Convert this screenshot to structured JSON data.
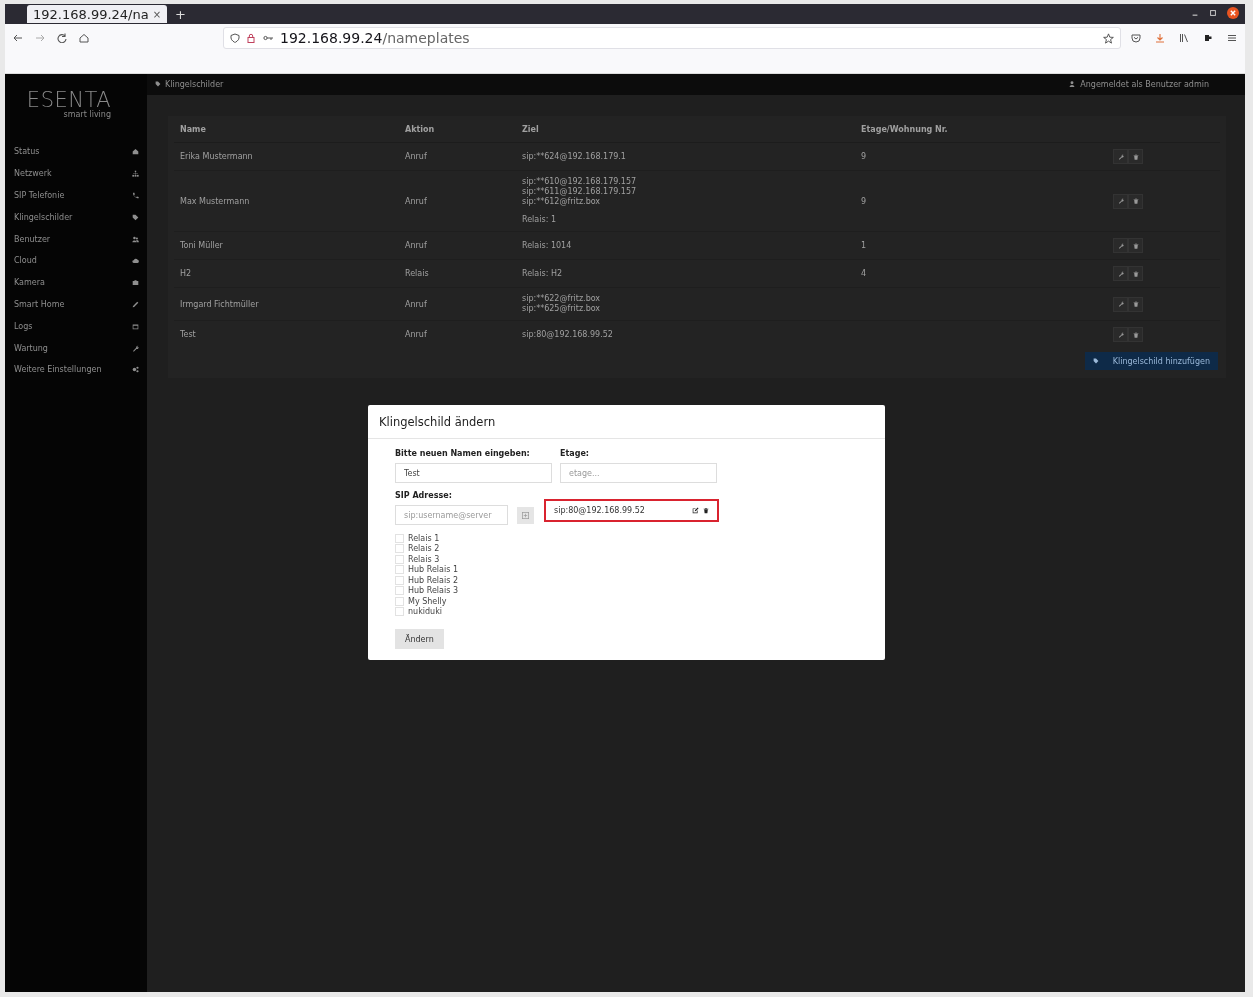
{
  "browser": {
    "tab_title": "192.168.99.24/na",
    "tab_close": "×",
    "new_tab": "+",
    "url_host": "192.168.99.24",
    "url_path": "/nameplates"
  },
  "sidebar": {
    "logo": "ESENTA",
    "tagline": "smart living",
    "items": [
      {
        "label": "Status"
      },
      {
        "label": "Netzwerk"
      },
      {
        "label": "SIP Telefonie"
      },
      {
        "label": "Klingelschilder"
      },
      {
        "label": "Benutzer"
      },
      {
        "label": "Cloud"
      },
      {
        "label": "Kamera"
      },
      {
        "label": "Smart Home"
      },
      {
        "label": "Logs"
      },
      {
        "label": "Wartung"
      },
      {
        "label": "Weitere Einstellungen"
      }
    ]
  },
  "header": {
    "title": "Klingelschilder",
    "user": "Angemeldet als Benutzer admin"
  },
  "table": {
    "columns": [
      "Name",
      "Aktion",
      "Ziel",
      "Etage/Wohnung Nr."
    ],
    "rows": [
      {
        "name": "Erika Mustermann",
        "action": "Anruf",
        "targets": [
          {
            "kind": "sip",
            "text": "sip:**624@192.168.179.1"
          }
        ],
        "floor": "9"
      },
      {
        "name": "Max Mustermann",
        "action": "Anruf",
        "targets": [
          {
            "kind": "sip",
            "text": "sip:**610@192.168.179.157"
          },
          {
            "kind": "sip",
            "text": "sip:**611@192.168.179.157"
          },
          {
            "kind": "sip",
            "text": "sip:**612@fritz.box"
          },
          {
            "kind": "relay",
            "text": "Relais: 1"
          }
        ],
        "floor": "9"
      },
      {
        "name": "Toni Müller",
        "action": "Anruf",
        "targets": [
          {
            "kind": "relay",
            "text": "Relais: 1014"
          }
        ],
        "floor": "1"
      },
      {
        "name": "H2",
        "action": "Relais",
        "targets": [
          {
            "kind": "relay",
            "text": "Relais: H2"
          }
        ],
        "floor": "4"
      },
      {
        "name": "Irmgard Fichtmüller",
        "action": "Anruf",
        "targets": [
          {
            "kind": "sip",
            "text": "sip:**622@fritz.box"
          },
          {
            "kind": "sip",
            "text": "sip:**625@fritz.box"
          }
        ]
      },
      {
        "name": "Test",
        "action": "Anruf",
        "targets": [
          {
            "kind": "sip",
            "text": "sip:80@192.168.99.52"
          }
        ]
      }
    ],
    "add_button": "Klingelschild hinzufügen"
  },
  "modal": {
    "title": "Klingelschild ändern",
    "name_label": "Bitte neuen Namen eingeben:",
    "name_value": "Test",
    "floor_label": "Etage:",
    "floor_placeholder": "etage...",
    "sip_label": "SIP Adresse:",
    "sip_placeholder": "sip:username@server",
    "sip_entries": [
      "sip:80@192.168.99.52"
    ],
    "relays": [
      {
        "label": "Relais 1",
        "checked": false
      },
      {
        "label": "Relais 2",
        "checked": false
      },
      {
        "label": "Relais 3",
        "checked": false
      },
      {
        "label": "Hub Relais 1",
        "checked": false
      },
      {
        "label": "Hub Relais 2",
        "checked": false
      },
      {
        "label": "Hub Relais 3",
        "checked": false
      },
      {
        "label": "My Shelly",
        "checked": false
      },
      {
        "label": "nukiduki",
        "checked": false
      }
    ],
    "submit": "Ändern"
  }
}
